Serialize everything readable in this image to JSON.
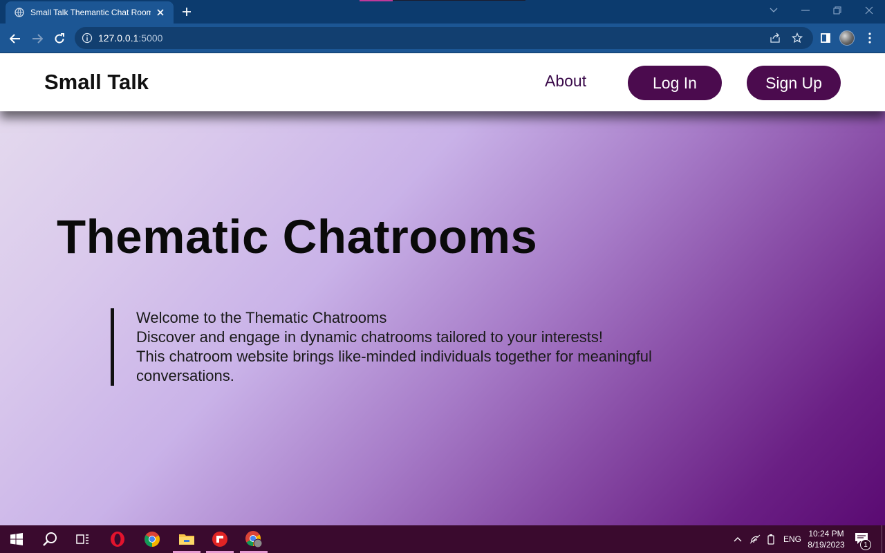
{
  "browser": {
    "tab_title": "Small Talk Themantic Chat Rooms",
    "url_host": "127.0.0.1",
    "url_port": ":5000"
  },
  "site": {
    "brand": "Small Talk",
    "nav": {
      "about_label": "About",
      "login_label": "Log In",
      "signup_label": "Sign Up"
    },
    "hero": {
      "title": "Thematic Chatrooms",
      "lines": [
        "Welcome to the Thematic Chatrooms",
        "Discover and engage in dynamic chatrooms tailored to your interests!",
        "This chatroom website brings like-minded individuals together for meaningful conversations."
      ]
    },
    "colors": {
      "accent": "#4b0b4e",
      "gradient_start": "#e6ddee",
      "gradient_end": "#5a0a72"
    }
  },
  "taskbar": {
    "apps": [
      "windows-start",
      "search",
      "task-view",
      "opera",
      "chrome",
      "file-explorer",
      "app-red",
      "chrome-profile"
    ],
    "language": "ENG",
    "time": "10:24 PM",
    "date": "8/19/2023",
    "notification_count": "1"
  }
}
